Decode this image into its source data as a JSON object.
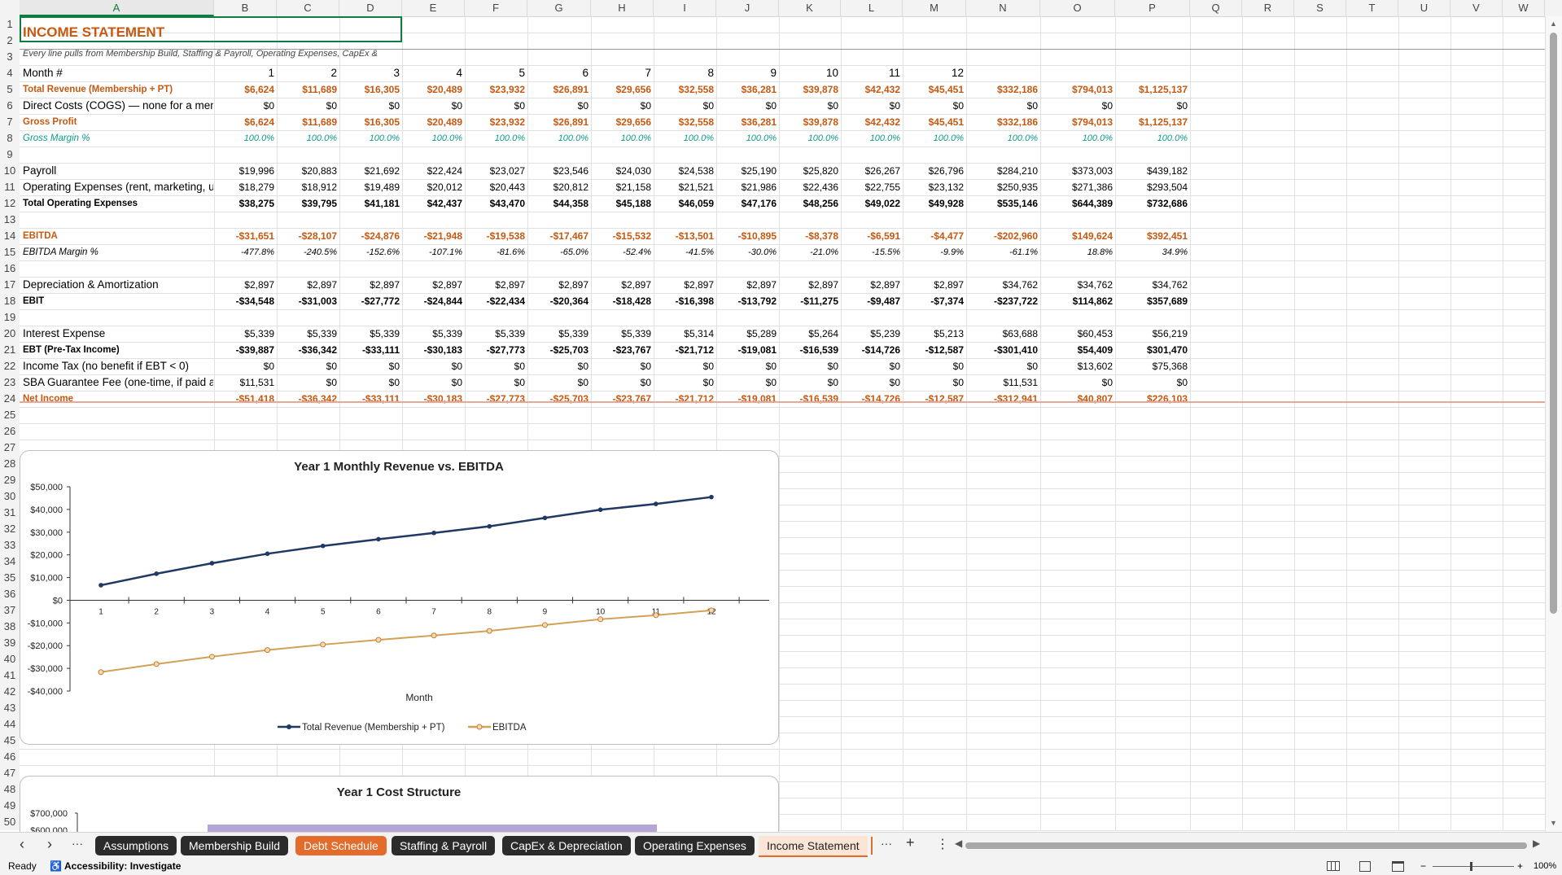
{
  "columns": [
    "A",
    "B",
    "C",
    "D",
    "E",
    "F",
    "G",
    "H",
    "I",
    "J",
    "K",
    "L",
    "M",
    "N",
    "O",
    "P",
    "Q",
    "R",
    "S",
    "T",
    "U",
    "V",
    "W"
  ],
  "sheet": {
    "title": "INCOME STATEMENT",
    "subtitle": "Every line pulls from Membership Build, Staffing & Payroll, Operating Expenses, CapEx &",
    "rows": [
      {
        "row": 4,
        "label": "Month #",
        "style": "plain",
        "values": [
          "1",
          "2",
          "3",
          "4",
          "5",
          "6",
          "7",
          "8",
          "9",
          "10",
          "11",
          "12",
          "",
          "",
          ""
        ]
      },
      {
        "row": 5,
        "label": "Total Revenue (Membership + PT)",
        "style": "bold-orange",
        "values": [
          "$6,624",
          "$11,689",
          "$16,305",
          "$20,489",
          "$23,932",
          "$26,891",
          "$29,656",
          "$32,558",
          "$36,281",
          "$39,878",
          "$42,432",
          "$45,451",
          "$332,186",
          "$794,013",
          "$1,125,137"
        ]
      },
      {
        "row": 6,
        "label": "Direct Costs (COGS) — none for a membership gym",
        "style": "plain",
        "values": [
          "$0",
          "$0",
          "$0",
          "$0",
          "$0",
          "$0",
          "$0",
          "$0",
          "$0",
          "$0",
          "$0",
          "$0",
          "$0",
          "$0",
          "$0"
        ]
      },
      {
        "row": 7,
        "label": "Gross Profit",
        "style": "bold-orange",
        "values": [
          "$6,624",
          "$11,689",
          "$16,305",
          "$20,489",
          "$23,932",
          "$26,891",
          "$29,656",
          "$32,558",
          "$36,281",
          "$39,878",
          "$42,432",
          "$45,451",
          "$332,186",
          "$794,013",
          "$1,125,137"
        ]
      },
      {
        "row": 8,
        "label": "Gross Margin %",
        "style": "italic-teal",
        "values": [
          "100.0%",
          "100.0%",
          "100.0%",
          "100.0%",
          "100.0%",
          "100.0%",
          "100.0%",
          "100.0%",
          "100.0%",
          "100.0%",
          "100.0%",
          "100.0%",
          "100.0%",
          "100.0%",
          "100.0%"
        ]
      },
      {
        "row": 10,
        "label": "Payroll",
        "style": "plain",
        "values": [
          "$19,996",
          "$20,883",
          "$21,692",
          "$22,424",
          "$23,027",
          "$23,546",
          "$24,030",
          "$24,538",
          "$25,190",
          "$25,820",
          "$26,267",
          "$26,796",
          "$284,210",
          "$373,003",
          "$439,182"
        ]
      },
      {
        "row": 11,
        "label": "Operating Expenses (rent, marketing, utilities)",
        "style": "plain",
        "values": [
          "$18,279",
          "$18,912",
          "$19,489",
          "$20,012",
          "$20,443",
          "$20,812",
          "$21,158",
          "$21,521",
          "$21,986",
          "$22,436",
          "$22,755",
          "$23,132",
          "$250,935",
          "$271,386",
          "$293,504"
        ]
      },
      {
        "row": 12,
        "label": "Total Operating Expenses",
        "style": "bold",
        "values": [
          "$38,275",
          "$39,795",
          "$41,181",
          "$42,437",
          "$43,470",
          "$44,358",
          "$45,188",
          "$46,059",
          "$47,176",
          "$48,256",
          "$49,022",
          "$49,928",
          "$535,146",
          "$644,389",
          "$732,686"
        ]
      },
      {
        "row": 14,
        "label": "EBITDA",
        "style": "bold-orange",
        "values": [
          "-$31,651",
          "-$28,107",
          "-$24,876",
          "-$21,948",
          "-$19,538",
          "-$17,467",
          "-$15,532",
          "-$13,501",
          "-$10,895",
          "-$8,378",
          "-$6,591",
          "-$4,477",
          "-$202,960",
          "$149,624",
          "$392,451"
        ]
      },
      {
        "row": 15,
        "label": "EBITDA Margin %",
        "style": "italic",
        "values": [
          "-477.8%",
          "-240.5%",
          "-152.6%",
          "-107.1%",
          "-81.6%",
          "-65.0%",
          "-52.4%",
          "-41.5%",
          "-30.0%",
          "-21.0%",
          "-15.5%",
          "-9.9%",
          "-61.1%",
          "18.8%",
          "34.9%"
        ]
      },
      {
        "row": 17,
        "label": "Depreciation & Amortization",
        "style": "plain",
        "values": [
          "$2,897",
          "$2,897",
          "$2,897",
          "$2,897",
          "$2,897",
          "$2,897",
          "$2,897",
          "$2,897",
          "$2,897",
          "$2,897",
          "$2,897",
          "$2,897",
          "$34,762",
          "$34,762",
          "$34,762"
        ]
      },
      {
        "row": 18,
        "label": "EBIT",
        "style": "bold",
        "values": [
          "-$34,548",
          "-$31,003",
          "-$27,772",
          "-$24,844",
          "-$22,434",
          "-$20,364",
          "-$18,428",
          "-$16,398",
          "-$13,792",
          "-$11,275",
          "-$9,487",
          "-$7,374",
          "-$237,722",
          "$114,862",
          "$357,689"
        ]
      },
      {
        "row": 20,
        "label": "Interest Expense",
        "style": "plain",
        "values": [
          "$5,339",
          "$5,339",
          "$5,339",
          "$5,339",
          "$5,339",
          "$5,339",
          "$5,339",
          "$5,314",
          "$5,289",
          "$5,264",
          "$5,239",
          "$5,213",
          "$63,688",
          "$60,453",
          "$56,219"
        ]
      },
      {
        "row": 21,
        "label": "EBT (Pre-Tax Income)",
        "style": "bold",
        "values": [
          "-$39,887",
          "-$36,342",
          "-$33,111",
          "-$30,183",
          "-$27,773",
          "-$25,703",
          "-$23,767",
          "-$21,712",
          "-$19,081",
          "-$16,539",
          "-$14,726",
          "-$12,587",
          "-$301,410",
          "$54,409",
          "$301,470"
        ]
      },
      {
        "row": 22,
        "label": "Income Tax (no benefit if EBT < 0)",
        "style": "plain",
        "values": [
          "$0",
          "$0",
          "$0",
          "$0",
          "$0",
          "$0",
          "$0",
          "$0",
          "$0",
          "$0",
          "$0",
          "$0",
          "$0",
          "$13,602",
          "$75,368"
        ]
      },
      {
        "row": 23,
        "label": "SBA Guarantee Fee (one-time, if paid at close)",
        "style": "plain",
        "values": [
          "$11,531",
          "$0",
          "$0",
          "$0",
          "$0",
          "$0",
          "$0",
          "$0",
          "$0",
          "$0",
          "$0",
          "$0",
          "$11,531",
          "$0",
          "$0"
        ]
      },
      {
        "row": 24,
        "label": "Net Income",
        "style": "bold-orange",
        "values": [
          "-$51,418",
          "-$36,342",
          "-$33,111",
          "-$30,183",
          "-$27,773",
          "-$25,703",
          "-$23,767",
          "-$21,712",
          "-$19,081",
          "-$16,539",
          "-$14,726",
          "-$12,587",
          "-$312,941",
          "$40,807",
          "$226,103"
        ]
      }
    ]
  },
  "chart1": {
    "title": "Year 1 Monthly Revenue vs. EBITDA",
    "xlabel": "Month",
    "yticks": [
      "$50,000",
      "$40,000",
      "$30,000",
      "$20,000",
      "$10,000",
      "$0",
      "-$10,000",
      "-$20,000",
      "-$30,000",
      "-$40,000"
    ],
    "legend": [
      "Total Revenue (Membership + PT)",
      "EBITDA"
    ]
  },
  "chart2": {
    "title": "Year 1 Cost Structure",
    "yticks": [
      "$700,000",
      "$600,000"
    ]
  },
  "chart_data": {
    "type": "line",
    "title": "Year 1 Monthly Revenue vs. EBITDA",
    "xlabel": "Month",
    "ylabel": "",
    "x": [
      1,
      2,
      3,
      4,
      5,
      6,
      7,
      8,
      9,
      10,
      11,
      12
    ],
    "ylim": [
      -40000,
      50000
    ],
    "series": [
      {
        "name": "Total Revenue (Membership + PT)",
        "color": "#1f3864",
        "values": [
          6624,
          11689,
          16305,
          20489,
          23932,
          26891,
          29656,
          32558,
          36281,
          39878,
          42432,
          45451
        ]
      },
      {
        "name": "EBITDA",
        "color": "#d4a055",
        "values": [
          -31651,
          -28107,
          -24876,
          -21948,
          -19538,
          -17467,
          -15532,
          -13501,
          -10895,
          -8378,
          -6591,
          -4477
        ]
      }
    ],
    "legend_position": "bottom",
    "grid": false
  },
  "tabs": [
    {
      "label": "Assumptions",
      "color": "#2b2b2b"
    },
    {
      "label": "Membership Build",
      "color": "#2b2b2b"
    },
    {
      "label": "Debt Schedule",
      "color": "#e36c2c"
    },
    {
      "label": "Staffing & Payroll",
      "color": "#2b2b2b"
    },
    {
      "label": "CapEx & Depreciation",
      "color": "#2b2b2b"
    },
    {
      "label": "Operating Expenses",
      "color": "#2b2b2b"
    },
    {
      "label": "Income Statement",
      "color": "active"
    }
  ],
  "nav": {
    "prev": "‹",
    "next": "›",
    "more": "···",
    "more2": "···",
    "add": "+",
    "menu": "⋮"
  },
  "status": {
    "ready": "Ready",
    "accessibility": "Accessibility: Investigate",
    "zoom": "100%",
    "zoom_out": "−",
    "zoom_in": "+"
  }
}
